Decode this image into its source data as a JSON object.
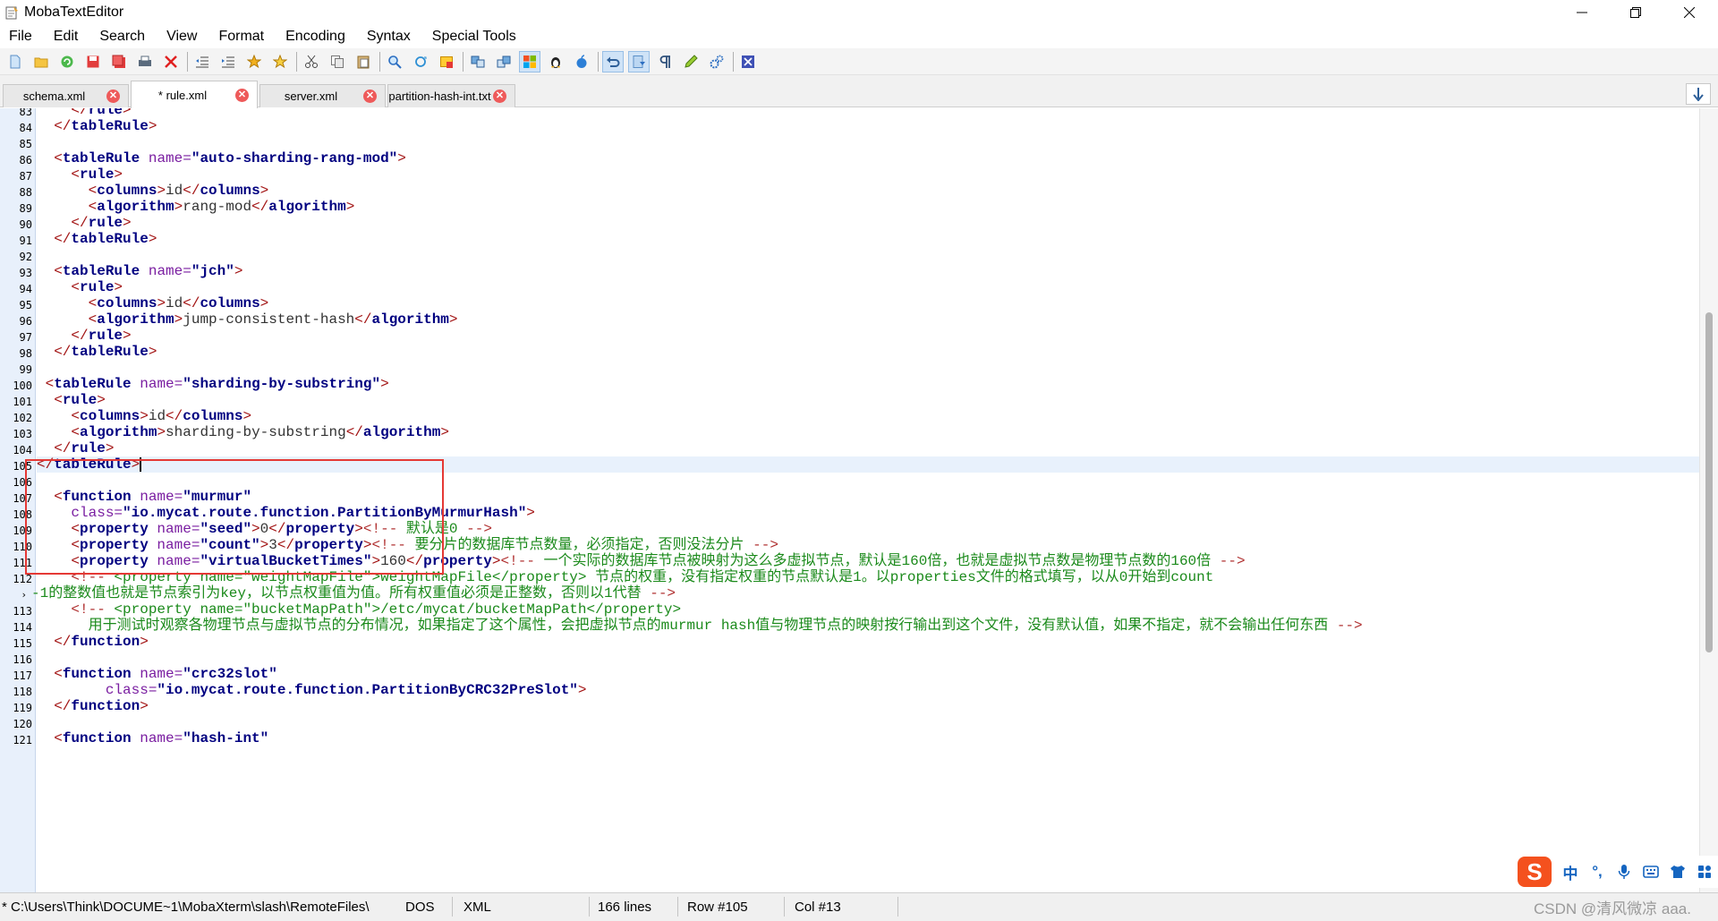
{
  "window": {
    "title": "MobaTextEditor",
    "controls": {
      "minimize": "minimize",
      "maximize": "restore",
      "close": "close"
    }
  },
  "menu": [
    "File",
    "Edit",
    "Search",
    "View",
    "Format",
    "Encoding",
    "Syntax",
    "Special Tools"
  ],
  "toolbar": {
    "icons": [
      "new-file-icon",
      "open-folder-icon",
      "refresh-icon",
      "save-icon",
      "save-all-icon",
      "print-icon",
      "close-file-icon",
      "indent-left-icon",
      "indent-right-icon",
      "bookmark-star-icon",
      "bookmark-next-icon",
      "cut-icon",
      "copy-icon",
      "paste-icon",
      "find-icon",
      "find-replace-icon",
      "highlight-icon",
      "compare-left-icon",
      "compare-right-icon",
      "windows-format-icon",
      "linux-format-icon",
      "mac-format-icon",
      "undo-icon",
      "word-wrap-icon",
      "pilcrow-icon",
      "pencil-icon",
      "settings-gears-icon",
      "close-x-icon"
    ],
    "active": [
      "windows-format-icon",
      "undo-icon",
      "word-wrap-icon"
    ]
  },
  "tabs": [
    {
      "label": "schema.xml",
      "active": false
    },
    {
      "label": "* rule.xml",
      "active": true
    },
    {
      "label": "server.xml",
      "active": false
    },
    {
      "label": "partition-hash-int.txt",
      "active": false
    }
  ],
  "tab_close_glyph": "✕",
  "editor": {
    "current_line": "105",
    "lines": [
      {
        "n": "83",
        "segs": [
          [
            "    ",
            "t-txt"
          ],
          [
            "</",
            "t-tag"
          ],
          [
            "rule",
            "t-el"
          ],
          [
            ">",
            "t-tag"
          ]
        ]
      },
      {
        "n": "84",
        "segs": [
          [
            "  ",
            "t-txt"
          ],
          [
            "</",
            "t-tag"
          ],
          [
            "tableRule",
            "t-el"
          ],
          [
            ">",
            "t-tag"
          ]
        ]
      },
      {
        "n": "85",
        "segs": []
      },
      {
        "n": "86",
        "segs": [
          [
            "  ",
            "t-txt"
          ],
          [
            "<",
            "t-tag"
          ],
          [
            "tableRule",
            "t-el"
          ],
          [
            " name=",
            "t-attr"
          ],
          [
            "\"auto-sharding-rang-mod\"",
            "t-str"
          ],
          [
            ">",
            "t-tag"
          ]
        ]
      },
      {
        "n": "87",
        "segs": [
          [
            "    ",
            "t-txt"
          ],
          [
            "<",
            "t-tag"
          ],
          [
            "rule",
            "t-el"
          ],
          [
            ">",
            "t-tag"
          ]
        ]
      },
      {
        "n": "88",
        "segs": [
          [
            "      ",
            "t-txt"
          ],
          [
            "<",
            "t-tag"
          ],
          [
            "columns",
            "t-el"
          ],
          [
            ">",
            "t-tag"
          ],
          [
            "id",
            "t-txt"
          ],
          [
            "</",
            "t-tag"
          ],
          [
            "columns",
            "t-el"
          ],
          [
            ">",
            "t-tag"
          ]
        ]
      },
      {
        "n": "89",
        "segs": [
          [
            "      ",
            "t-txt"
          ],
          [
            "<",
            "t-tag"
          ],
          [
            "algorithm",
            "t-el"
          ],
          [
            ">",
            "t-tag"
          ],
          [
            "rang-mod",
            "t-txt"
          ],
          [
            "</",
            "t-tag"
          ],
          [
            "algorithm",
            "t-el"
          ],
          [
            ">",
            "t-tag"
          ]
        ]
      },
      {
        "n": "90",
        "segs": [
          [
            "    ",
            "t-txt"
          ],
          [
            "</",
            "t-tag"
          ],
          [
            "rule",
            "t-el"
          ],
          [
            ">",
            "t-tag"
          ]
        ]
      },
      {
        "n": "91",
        "segs": [
          [
            "  ",
            "t-txt"
          ],
          [
            "</",
            "t-tag"
          ],
          [
            "tableRule",
            "t-el"
          ],
          [
            ">",
            "t-tag"
          ]
        ]
      },
      {
        "n": "92",
        "segs": []
      },
      {
        "n": "93",
        "segs": [
          [
            "  ",
            "t-txt"
          ],
          [
            "<",
            "t-tag"
          ],
          [
            "tableRule",
            "t-el"
          ],
          [
            " name=",
            "t-attr"
          ],
          [
            "\"jch\"",
            "t-str"
          ],
          [
            ">",
            "t-tag"
          ]
        ]
      },
      {
        "n": "94",
        "segs": [
          [
            "    ",
            "t-txt"
          ],
          [
            "<",
            "t-tag"
          ],
          [
            "rule",
            "t-el"
          ],
          [
            ">",
            "t-tag"
          ]
        ]
      },
      {
        "n": "95",
        "segs": [
          [
            "      ",
            "t-txt"
          ],
          [
            "<",
            "t-tag"
          ],
          [
            "columns",
            "t-el"
          ],
          [
            ">",
            "t-tag"
          ],
          [
            "id",
            "t-txt"
          ],
          [
            "</",
            "t-tag"
          ],
          [
            "columns",
            "t-el"
          ],
          [
            ">",
            "t-tag"
          ]
        ]
      },
      {
        "n": "96",
        "segs": [
          [
            "      ",
            "t-txt"
          ],
          [
            "<",
            "t-tag"
          ],
          [
            "algorithm",
            "t-el"
          ],
          [
            ">",
            "t-tag"
          ],
          [
            "jump-consistent-hash",
            "t-txt"
          ],
          [
            "</",
            "t-tag"
          ],
          [
            "algorithm",
            "t-el"
          ],
          [
            ">",
            "t-tag"
          ]
        ]
      },
      {
        "n": "97",
        "segs": [
          [
            "    ",
            "t-txt"
          ],
          [
            "</",
            "t-tag"
          ],
          [
            "rule",
            "t-el"
          ],
          [
            ">",
            "t-tag"
          ]
        ]
      },
      {
        "n": "98",
        "segs": [
          [
            "  ",
            "t-txt"
          ],
          [
            "</",
            "t-tag"
          ],
          [
            "tableRule",
            "t-el"
          ],
          [
            ">",
            "t-tag"
          ]
        ]
      },
      {
        "n": "99",
        "segs": []
      },
      {
        "n": "100",
        "segs": [
          [
            " ",
            "t-txt"
          ],
          [
            "<",
            "t-tag"
          ],
          [
            "tableRule",
            "t-el"
          ],
          [
            " name=",
            "t-attr"
          ],
          [
            "\"sharding-by-substring\"",
            "t-str"
          ],
          [
            ">",
            "t-tag"
          ]
        ]
      },
      {
        "n": "101",
        "segs": [
          [
            "  ",
            "t-txt"
          ],
          [
            "<",
            "t-tag"
          ],
          [
            "rule",
            "t-el"
          ],
          [
            ">",
            "t-tag"
          ]
        ]
      },
      {
        "n": "102",
        "segs": [
          [
            "    ",
            "t-txt"
          ],
          [
            "<",
            "t-tag"
          ],
          [
            "columns",
            "t-el"
          ],
          [
            ">",
            "t-tag"
          ],
          [
            "id",
            "t-txt"
          ],
          [
            "</",
            "t-tag"
          ],
          [
            "columns",
            "t-el"
          ],
          [
            ">",
            "t-tag"
          ]
        ]
      },
      {
        "n": "103",
        "segs": [
          [
            "    ",
            "t-txt"
          ],
          [
            "<",
            "t-tag"
          ],
          [
            "algorithm",
            "t-el"
          ],
          [
            ">",
            "t-tag"
          ],
          [
            "sharding-by-substring",
            "t-txt"
          ],
          [
            "</",
            "t-tag"
          ],
          [
            "algorithm",
            "t-el"
          ],
          [
            ">",
            "t-tag"
          ]
        ]
      },
      {
        "n": "104",
        "segs": [
          [
            "  ",
            "t-txt"
          ],
          [
            "</",
            "t-tag"
          ],
          [
            "rule",
            "t-el"
          ],
          [
            ">",
            "t-tag"
          ]
        ]
      },
      {
        "n": "105",
        "segs": [
          [
            "</",
            "t-tag"
          ],
          [
            "tableRule",
            "t-el"
          ],
          [
            ">",
            "t-tag"
          ]
        ]
      },
      {
        "n": "106",
        "segs": []
      },
      {
        "n": "107",
        "segs": [
          [
            "  ",
            "t-txt"
          ],
          [
            "<",
            "t-tag"
          ],
          [
            "function",
            "t-el"
          ],
          [
            " name=",
            "t-attr"
          ],
          [
            "\"murmur\"",
            "t-str"
          ]
        ]
      },
      {
        "n": "108",
        "segs": [
          [
            "    ",
            "t-txt"
          ],
          [
            "class=",
            "t-attr"
          ],
          [
            "\"io.mycat.route.function.PartitionByMurmurHash\"",
            "t-str"
          ],
          [
            ">",
            "t-tag"
          ]
        ]
      },
      {
        "n": "109",
        "segs": [
          [
            "    ",
            "t-txt"
          ],
          [
            "<",
            "t-tag"
          ],
          [
            "property",
            "t-el"
          ],
          [
            " name=",
            "t-attr"
          ],
          [
            "\"seed\"",
            "t-str"
          ],
          [
            ">",
            "t-tag"
          ],
          [
            "0",
            "t-txt"
          ],
          [
            "</",
            "t-tag"
          ],
          [
            "property",
            "t-el"
          ],
          [
            ">",
            "t-tag"
          ],
          [
            "<!-- ",
            "t-cmd"
          ],
          [
            "默认是0 ",
            "t-cm"
          ],
          [
            "-->",
            "t-cmd"
          ]
        ]
      },
      {
        "n": "110",
        "segs": [
          [
            "    ",
            "t-txt"
          ],
          [
            "<",
            "t-tag"
          ],
          [
            "property",
            "t-el"
          ],
          [
            " name=",
            "t-attr"
          ],
          [
            "\"count\"",
            "t-str"
          ],
          [
            ">",
            "t-tag"
          ],
          [
            "3",
            "t-txt"
          ],
          [
            "</",
            "t-tag"
          ],
          [
            "property",
            "t-el"
          ],
          [
            ">",
            "t-tag"
          ],
          [
            "<!-- ",
            "t-cmd"
          ],
          [
            "要分片的数据库节点数量，必须指定，否则没法分片 ",
            "t-cm"
          ],
          [
            "-->",
            "t-cmd"
          ]
        ]
      },
      {
        "n": "111",
        "segs": [
          [
            "    ",
            "t-txt"
          ],
          [
            "<",
            "t-tag"
          ],
          [
            "property",
            "t-el"
          ],
          [
            " name=",
            "t-attr"
          ],
          [
            "\"virtualBucketTimes\"",
            "t-str"
          ],
          [
            ">",
            "t-tag"
          ],
          [
            "160",
            "t-txt"
          ],
          [
            "</",
            "t-tag"
          ],
          [
            "property",
            "t-el"
          ],
          [
            ">",
            "t-tag"
          ],
          [
            "<!-- ",
            "t-cmd"
          ],
          [
            "一个实际的数据库节点被映射为这么多虚拟节点，默认是160倍，也就是虚拟节点数是物理节点数的160倍 ",
            "t-cm"
          ],
          [
            "-->",
            "t-cmd"
          ]
        ]
      },
      {
        "n": "112",
        "segs": [
          [
            "    ",
            "t-txt"
          ],
          [
            "<!-- ",
            "t-cmd"
          ],
          [
            "<property name=\"weightMapFile\">weightMapFile</property> 节点的权重，没有指定权重的节点默认是1。以properties文件的格式填写，以从0开始到count",
            "t-cm"
          ]
        ]
      },
      {
        "n": "",
        "wrap": true,
        "segs": [
          [
            "-1的整数值也就是节点索引为key，以节点权重值为值。所有权重值必须是正整数，否则以1代替 ",
            "t-cm"
          ],
          [
            "-->",
            "t-cmd"
          ]
        ]
      },
      {
        "n": "113",
        "segs": [
          [
            "    ",
            "t-txt"
          ],
          [
            "<!-- ",
            "t-cmd"
          ],
          [
            "<property name=\"bucketMapPath\">/etc/mycat/bucketMapPath</property>",
            "t-cm"
          ]
        ]
      },
      {
        "n": "114",
        "segs": [
          [
            "      用于测试时观察各物理节点与虚拟节点的分布情况，如果指定了这个属性，会把虚拟节点的murmur hash值与物理节点的映射按行输出到这个文件，没有默认值，如果不指定，就不会输出任何东西 ",
            "t-cm"
          ],
          [
            "-->",
            "t-cmd"
          ]
        ]
      },
      {
        "n": "115",
        "segs": [
          [
            "  ",
            "t-txt"
          ],
          [
            "</",
            "t-tag"
          ],
          [
            "function",
            "t-el"
          ],
          [
            ">",
            "t-tag"
          ]
        ]
      },
      {
        "n": "116",
        "segs": []
      },
      {
        "n": "117",
        "segs": [
          [
            "  ",
            "t-txt"
          ],
          [
            "<",
            "t-tag"
          ],
          [
            "function",
            "t-el"
          ],
          [
            " name=",
            "t-attr"
          ],
          [
            "\"crc32slot\"",
            "t-str"
          ]
        ]
      },
      {
        "n": "118",
        "segs": [
          [
            "        ",
            "t-txt"
          ],
          [
            "class=",
            "t-attr"
          ],
          [
            "\"io.mycat.route.function.PartitionByCRC32PreSlot\"",
            "t-str"
          ],
          [
            ">",
            "t-tag"
          ]
        ]
      },
      {
        "n": "119",
        "segs": [
          [
            "  ",
            "t-txt"
          ],
          [
            "</",
            "t-tag"
          ],
          [
            "function",
            "t-el"
          ],
          [
            ">",
            "t-tag"
          ]
        ]
      },
      {
        "n": "120",
        "segs": []
      },
      {
        "n": "121",
        "segs": [
          [
            "  ",
            "t-txt"
          ],
          [
            "<",
            "t-tag"
          ],
          [
            "function",
            "t-el"
          ],
          [
            " name=",
            "t-attr"
          ],
          [
            "\"hash-int\"",
            "t-str"
          ]
        ]
      }
    ]
  },
  "status": {
    "path": "* C:\\Users\\Think\\DOCUME~1\\MobaXterm\\slash\\RemoteFiles\\",
    "eol": "DOS",
    "syntax": "XML",
    "lines": "166 lines",
    "row": "Row #105",
    "col": "Col #13"
  },
  "ime": {
    "logo": "S",
    "lang": "中",
    "punct": "°,",
    "icons": [
      "microphone-icon",
      "keyboard-icon",
      "skin-icon",
      "grid-icon"
    ]
  },
  "watermark": "CSDN @清风微凉 aaa."
}
